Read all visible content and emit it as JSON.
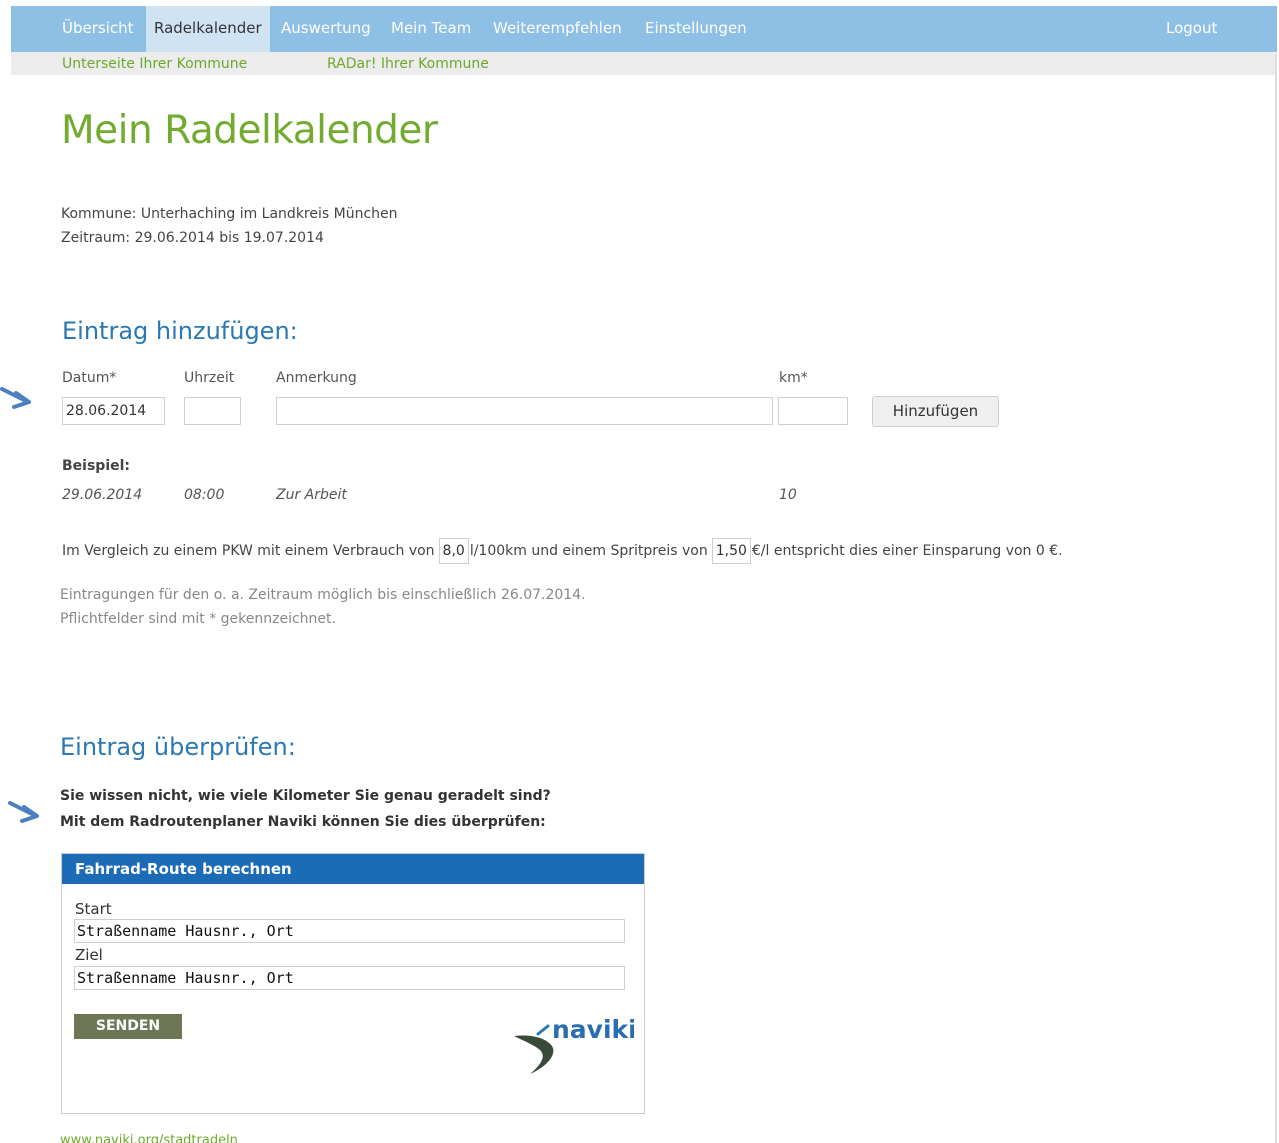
{
  "nav": {
    "items": [
      "Übersicht",
      "Radelkalender",
      "Auswertung",
      "Mein Team",
      "Weiterempfehlen",
      "Einstellungen"
    ],
    "logout": "Logout"
  },
  "subnav": {
    "items": [
      "Unterseite Ihrer Kommune",
      "RADar! Ihrer Kommune"
    ]
  },
  "page": {
    "title": "Mein Radelkalender",
    "kommune": "Kommune: Unterhaching im Landkreis München",
    "zeitraum": "Zeitraum: 29.06.2014 bis 19.07.2014"
  },
  "add": {
    "heading": "Eintrag hinzufügen:",
    "labels": {
      "datum": "Datum*",
      "uhrzeit": "Uhrzeit",
      "anmerkung": "Anmerkung",
      "km": "km*"
    },
    "values": {
      "datum": "28.06.2014",
      "uhrzeit": "",
      "anmerkung": "",
      "km": ""
    },
    "button": "Hinzufügen"
  },
  "example": {
    "title": "Beispiel:",
    "datum": "29.06.2014",
    "uhrzeit": "08:00",
    "anmerkung": "Zur Arbeit",
    "km": "10"
  },
  "calc": {
    "part1": "Im Vergleich zu einem PKW mit einem Verbrauch von",
    "verbrauch": "8,0",
    "part2": "l/100km und einem Spritpreis von",
    "preis": "1,50",
    "part3": "€/l entspricht dies einer Einsparung von 0 €."
  },
  "notes": {
    "line1": "Eintragungen für den o. a. Zeitraum möglich bis einschließlich 26.07.2014.",
    "line2": "Pflichtfelder sind mit * gekennzeichnet."
  },
  "check": {
    "heading": "Eintrag überprüfen:",
    "line1": "Sie wissen nicht, wie viele Kilometer Sie genau geradelt sind?",
    "line2": "Mit dem Radroutenplaner Naviki können Sie dies überprüfen:"
  },
  "widget": {
    "title": "Fahrrad-Route berechnen",
    "start_label": "Start",
    "start_value": "Straßenname Hausnr., Ort",
    "ziel_label": "Ziel",
    "ziel_value": "Straßenname Hausnr., Ort",
    "send": "SENDEN",
    "logo_text": "naviki"
  },
  "footer": {
    "link": "www.naviki.org/stadtradeln"
  },
  "colors": {
    "nav_bg": "#8ec0e6",
    "title_green": "#72ab2f",
    "heading_blue": "#2a78b4",
    "widget_blue": "#1c6bb6",
    "send_olive": "#6d7755",
    "arrow_blue": "#4b7fc1"
  }
}
